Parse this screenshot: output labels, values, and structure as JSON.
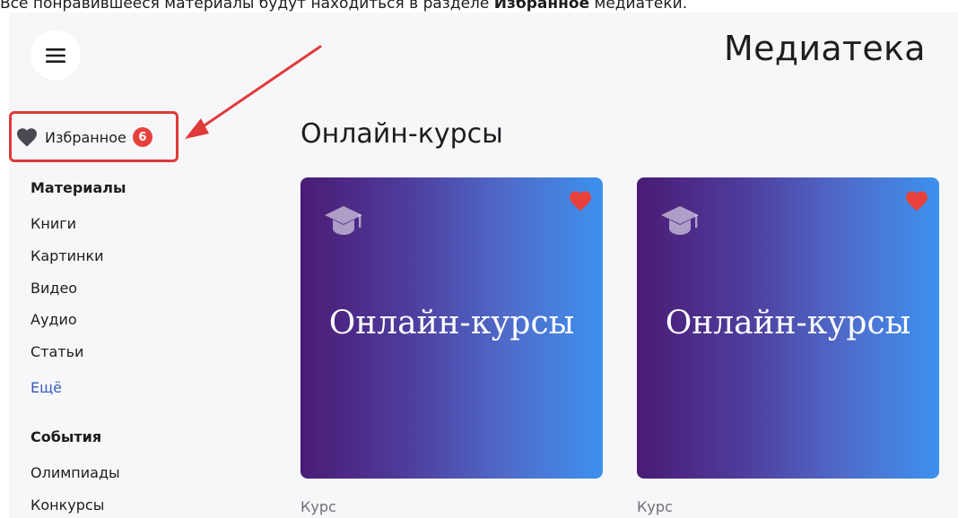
{
  "caption": {
    "before": "Все понравившееся материалы будут находиться в разделе ",
    "bold": "Избранное",
    "after": " медиатеки."
  },
  "header": {
    "title": "Медиатека",
    "menu_icon": "hamburger-menu-icon"
  },
  "sidebar": {
    "favorites": {
      "label": "Избранное",
      "count": "6",
      "icon": "heart-icon"
    },
    "groups": [
      {
        "heading": "Материалы",
        "items": [
          "Книги",
          "Картинки",
          "Видео",
          "Аудио",
          "Статьи"
        ],
        "more": "Ещё"
      },
      {
        "heading": "События",
        "items": [
          "Олимпиады",
          "Конкурсы"
        ]
      }
    ]
  },
  "main": {
    "section_title": "Онлайн-курсы",
    "cards": [
      {
        "title": "Онлайн-курсы",
        "type": "Курс",
        "icon": "graduation-cap-icon",
        "favorite": true
      },
      {
        "title": "Онлайн-курсы",
        "type": "Курс",
        "icon": "graduation-cap-icon",
        "favorite": true
      }
    ]
  },
  "colors": {
    "highlight": "#e03a3a",
    "badge": "#e8413c",
    "favorite_heart": "#e8413c",
    "link": "#3a5bb8",
    "card_gradient_start": "#4a1b74",
    "card_gradient_end": "#3d91ee"
  }
}
